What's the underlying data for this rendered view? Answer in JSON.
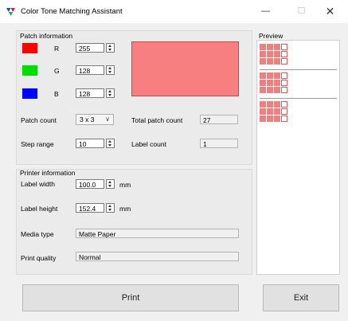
{
  "window": {
    "title": "Color Tone Matching Assistant",
    "minimize_glyph": "—",
    "maximize_glyph": "☐",
    "close_glyph": "✕"
  },
  "patch": {
    "group_label": "Patch information",
    "r_label": "R",
    "r_value": "255",
    "r_color": "#ff0000",
    "g_label": "G",
    "g_value": "128",
    "g_color": "#00dd00",
    "b_label": "B",
    "b_value": "128",
    "b_color": "#0000ff",
    "preview_color": "#f77f7f",
    "patch_count_label": "Patch count",
    "patch_count_value": "3 x 3",
    "total_label": "Total patch count",
    "total_value": "27",
    "step_label": "Step range",
    "step_value": "10",
    "label_count_label": "Label count",
    "label_count_value": "1"
  },
  "printer": {
    "group_label": "Printer information",
    "width_label": "Label width",
    "width_value": "100.0",
    "width_unit": "mm",
    "height_label": "Label height",
    "height_value": "152.4",
    "height_unit": "mm",
    "media_label": "Media type",
    "media_value": "Matte Paper",
    "quality_label": "Print quality",
    "quality_value": "Normal"
  },
  "preview": {
    "label": "Preview",
    "sheet_count": 3
  },
  "buttons": {
    "print": "Print",
    "exit": "Exit"
  },
  "icons": {
    "app": "app-palette-icon",
    "spin": "spin-updown-icon",
    "dropdown": "chevron-down-icon"
  }
}
